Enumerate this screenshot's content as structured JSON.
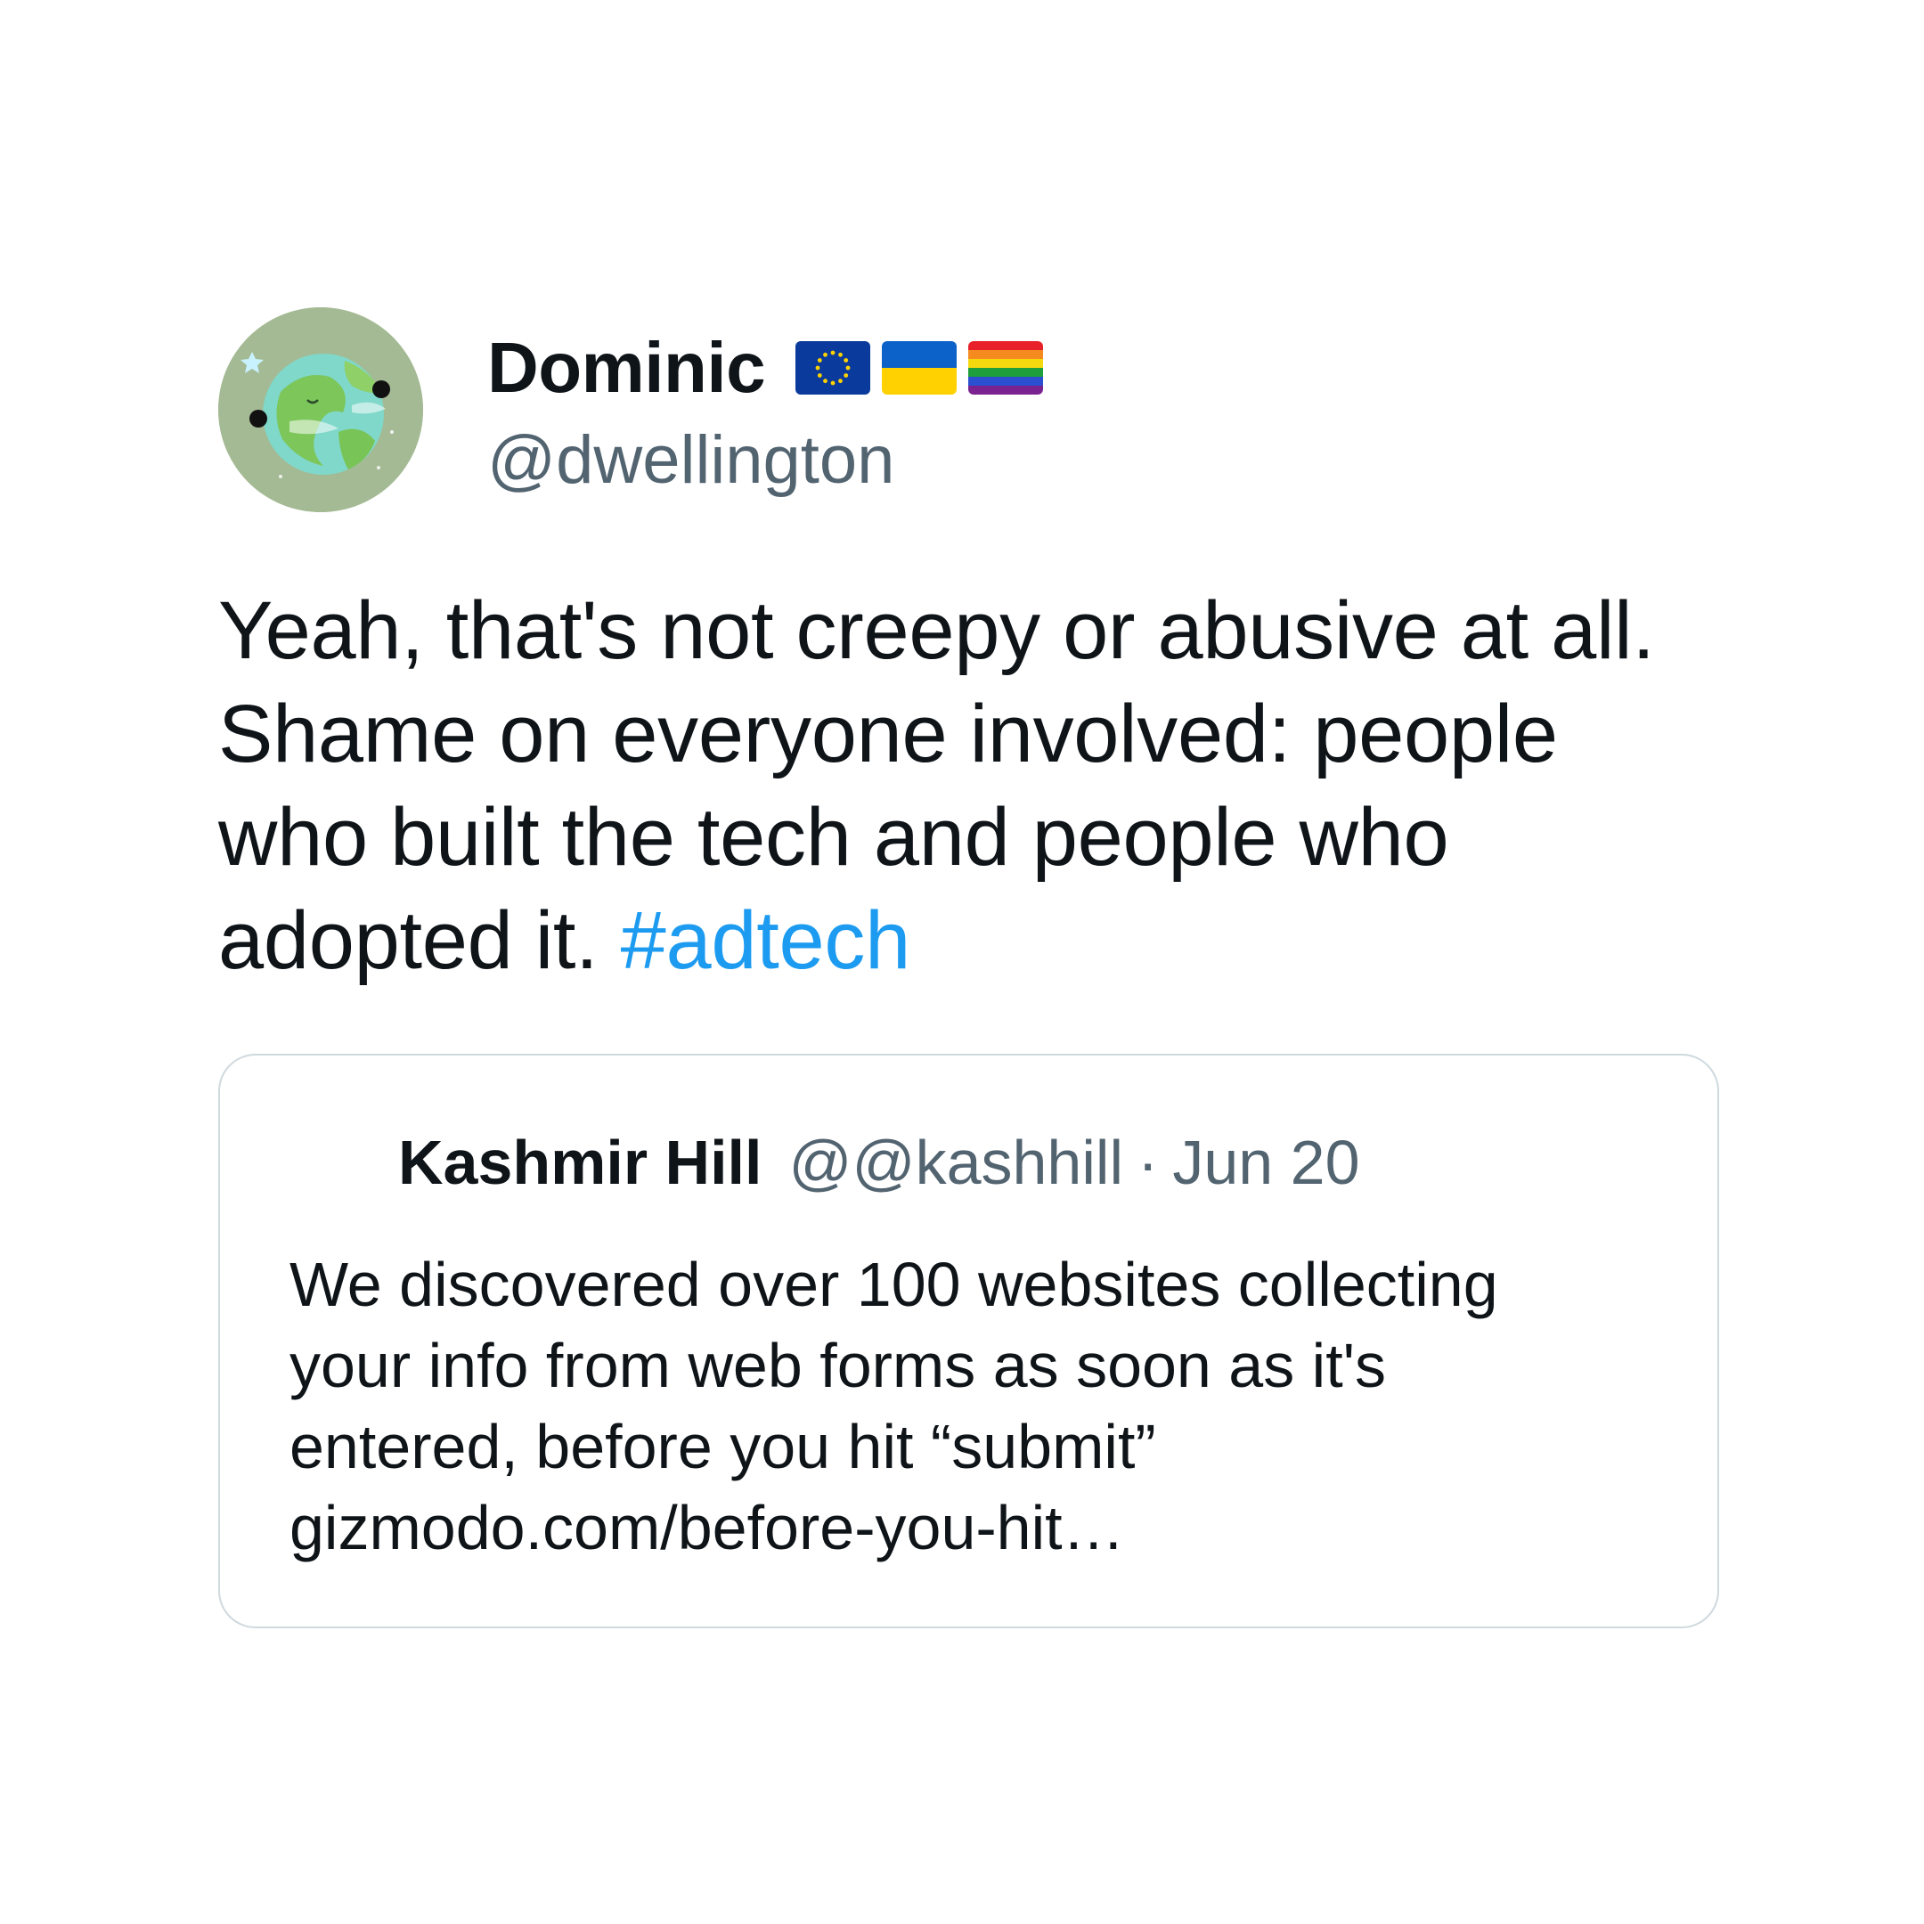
{
  "author": {
    "display_name": "Dominic",
    "handle": "@dwellington",
    "avatar_icon": "earth-avatar-icon",
    "flags": [
      "eu-flag-icon",
      "ukraine-flag-icon",
      "rainbow-flag-icon"
    ]
  },
  "tweet": {
    "text_main": "Yeah, that's not creepy or abusive at all. Shame on everyone involved: people who built the tech and people who adopted it. ",
    "hashtag": "#adtech"
  },
  "quoted": {
    "name": "Kashmir Hill",
    "handle": "@@kashhill",
    "separator": "·",
    "date": "Jun 20",
    "lines": [
      "We discovered over 100 websites collecting",
      "your info from web forms as soon as it's",
      "entered, before you hit “submit”",
      "gizmodo.com/before-you-hit…"
    ]
  },
  "colors": {
    "text": "#0f1419",
    "secondary": "#536471",
    "link": "#1d9bf0",
    "border": "#cfd9de"
  }
}
